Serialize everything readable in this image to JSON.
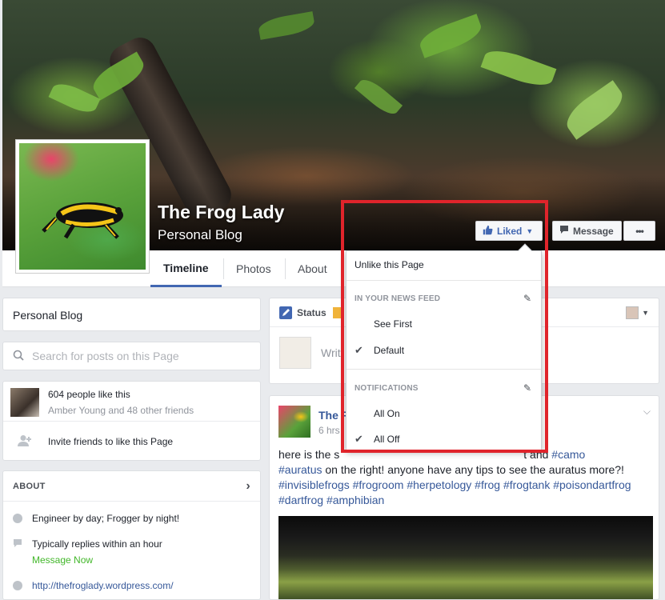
{
  "colors": {
    "accent": "#4267b2",
    "highlight": "#e0242b",
    "link": "#365899",
    "cta": "#42b72a"
  },
  "cover": {
    "title": "The Frog Lady",
    "subtitle": "Personal Blog"
  },
  "cover_buttons": {
    "liked": "Liked",
    "message": "Message",
    "more": "•••"
  },
  "tabs": [
    "Timeline",
    "Photos",
    "About"
  ],
  "left": {
    "category": "Personal Blog",
    "search_placeholder": "Search for posts on this Page",
    "likes_count": "604 people like this",
    "likes_friends": "Amber Young and 48 other friends",
    "invite": "Invite friends to like this Page",
    "about": {
      "header": "ABOUT",
      "bio": "Engineer by day; Frogger by night!",
      "response": "Typically replies within an hour",
      "message_now": "Message Now",
      "website": "http://thefroglady.wordpress.com/"
    }
  },
  "composer": {
    "status_tab": "Status",
    "placeholder": "Writ"
  },
  "post": {
    "author": "The F",
    "time": "6 hrs",
    "line1_start": "here is the s",
    "line1_end": "t and",
    "tags": [
      "#camo",
      "#auratus",
      "#invisiblefrogs",
      "#frogroom",
      "#herpetology",
      "#frog",
      "#frogtank",
      "#poisondartfrog",
      "#dartfrog",
      "#amphibian"
    ],
    "line2_mid": " on the right! anyone have any tips to see the auratus more?!"
  },
  "dropdown": {
    "unlike": "Unlike this Page",
    "news_feed_header": "IN YOUR NEWS FEED",
    "see_first": "See First",
    "default": "Default",
    "notifications_header": "NOTIFICATIONS",
    "all_on": "All On",
    "all_off": "All Off",
    "selected_feed": "Default",
    "selected_notifications": "All Off"
  },
  "icons": [
    "thumbs-up-icon",
    "caret-down-icon",
    "message-icon",
    "search-icon",
    "add-user-icon",
    "chevron-right-icon",
    "info-icon",
    "chat-icon",
    "globe-icon",
    "pencil-icon",
    "checkmark-icon",
    "status-icon"
  ]
}
